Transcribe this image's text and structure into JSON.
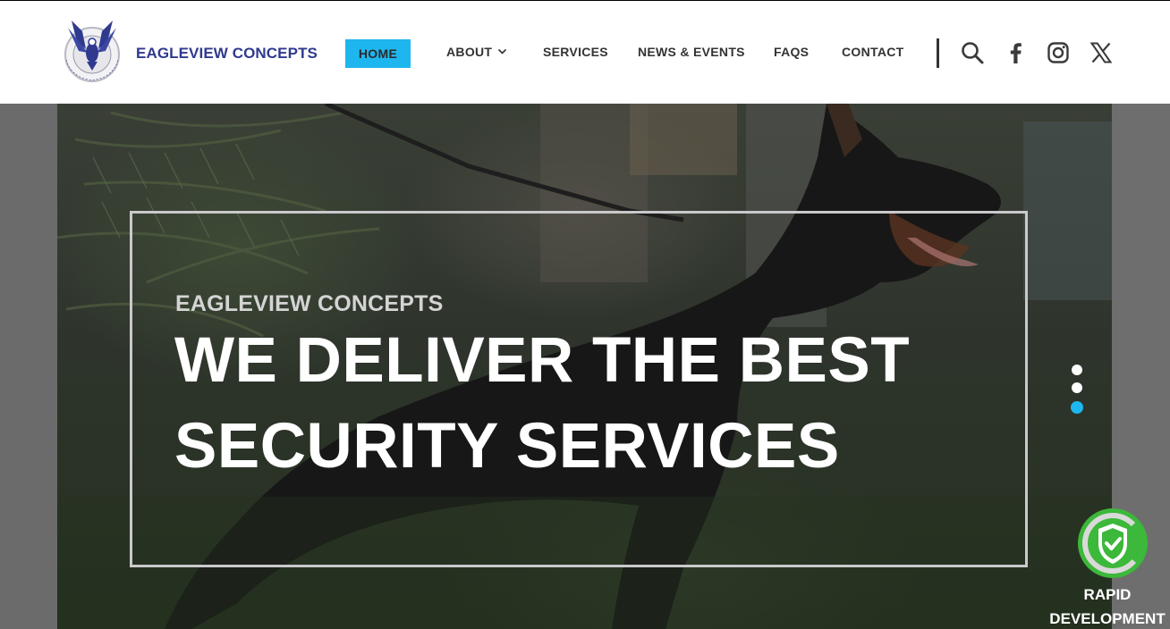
{
  "brand": {
    "name": "EAGLEVIEW CONCEPTS",
    "logo_icon": "eagle-logo-icon",
    "logo_text": "EAGLEVIEW CONCEPTS NIGERIA"
  },
  "nav": {
    "home": "HOME",
    "about": "ABOUT",
    "services": "SERVICES",
    "news": "NEWS & EVENTS",
    "faqs": "FAQS",
    "contact": "CONTACT"
  },
  "header_icons": [
    "search-icon",
    "facebook-icon",
    "instagram-icon",
    "x-twitter-icon"
  ],
  "hero": {
    "kicker": "EAGLEVIEW CONCEPTS",
    "headline_line1": "WE DELIVER THE BEST",
    "headline_line2": "SECURITY SERVICES",
    "slides_total": 3,
    "active_slide": 3
  },
  "badge": {
    "line1": "RAPID",
    "line2": "DEVELOPMENT",
    "icon": "shield-check-icon"
  },
  "colors": {
    "accent": "#1eb6ee",
    "brand": "#2f3a8f",
    "badge_green": "#3cb83a"
  }
}
